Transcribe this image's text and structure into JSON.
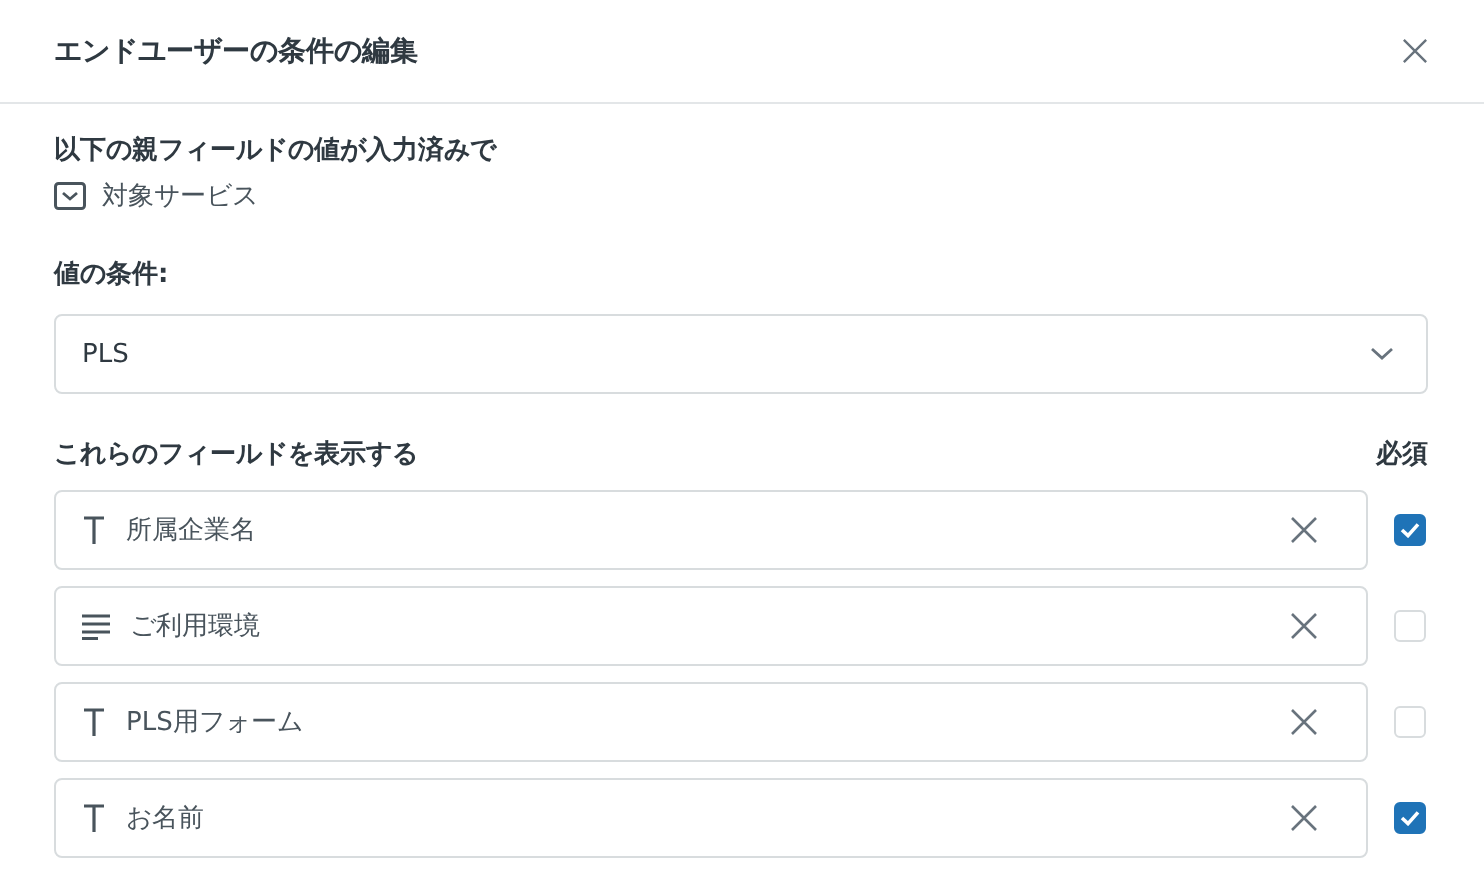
{
  "dialog": {
    "title": "エンドユーザーの条件の編集"
  },
  "parent": {
    "label": "以下の親フィールドの値が入力済みで",
    "field": "対象サービス"
  },
  "condition": {
    "label": "値の条件:",
    "value": "PLS"
  },
  "fields_header": {
    "label": "これらのフィールドを表示する",
    "required_label": "必須"
  },
  "fields": [
    {
      "kind": "text",
      "name": "所属企業名",
      "required": true
    },
    {
      "kind": "paragraph",
      "name": "ご利用環境",
      "required": false
    },
    {
      "kind": "text",
      "name": "PLS用フォーム",
      "required": false
    },
    {
      "kind": "text",
      "name": "お名前",
      "required": true
    }
  ]
}
